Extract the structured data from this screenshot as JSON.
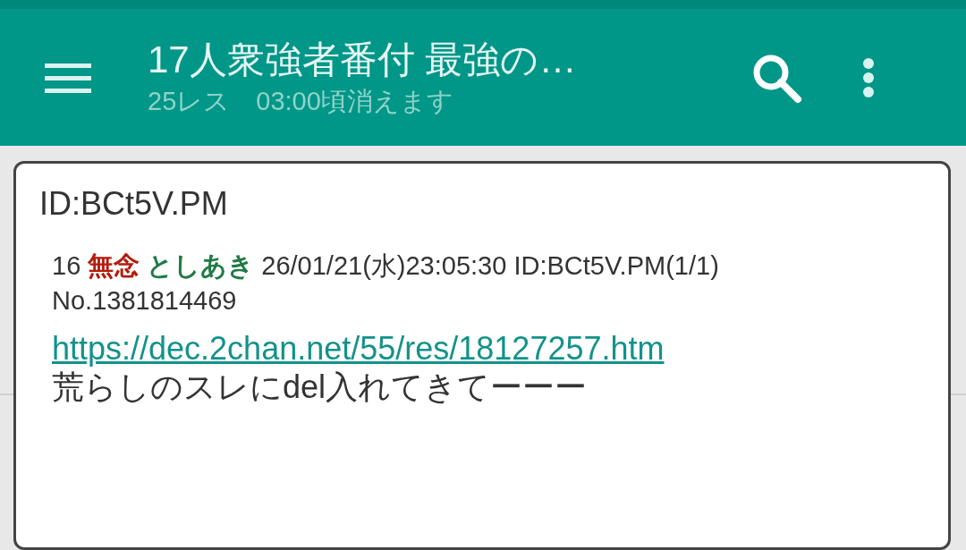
{
  "app_bar": {
    "title": "17人衆強者番付 最強の…",
    "subtitle": "25レス　03:00頃消えます"
  },
  "popup": {
    "title": "ID:BCt5V.PM",
    "post": {
      "number": "16",
      "subject": "無念",
      "name": "としあき",
      "date_id": "26/01/21(水)23:05:30 ID:BCt5V.PM(1/1)",
      "post_no": "No.1381814469",
      "link": "https://dec.2chan.net/55/res/18127257.htm",
      "body": "荒らしのスレにdel入れてきてーーー"
    }
  }
}
